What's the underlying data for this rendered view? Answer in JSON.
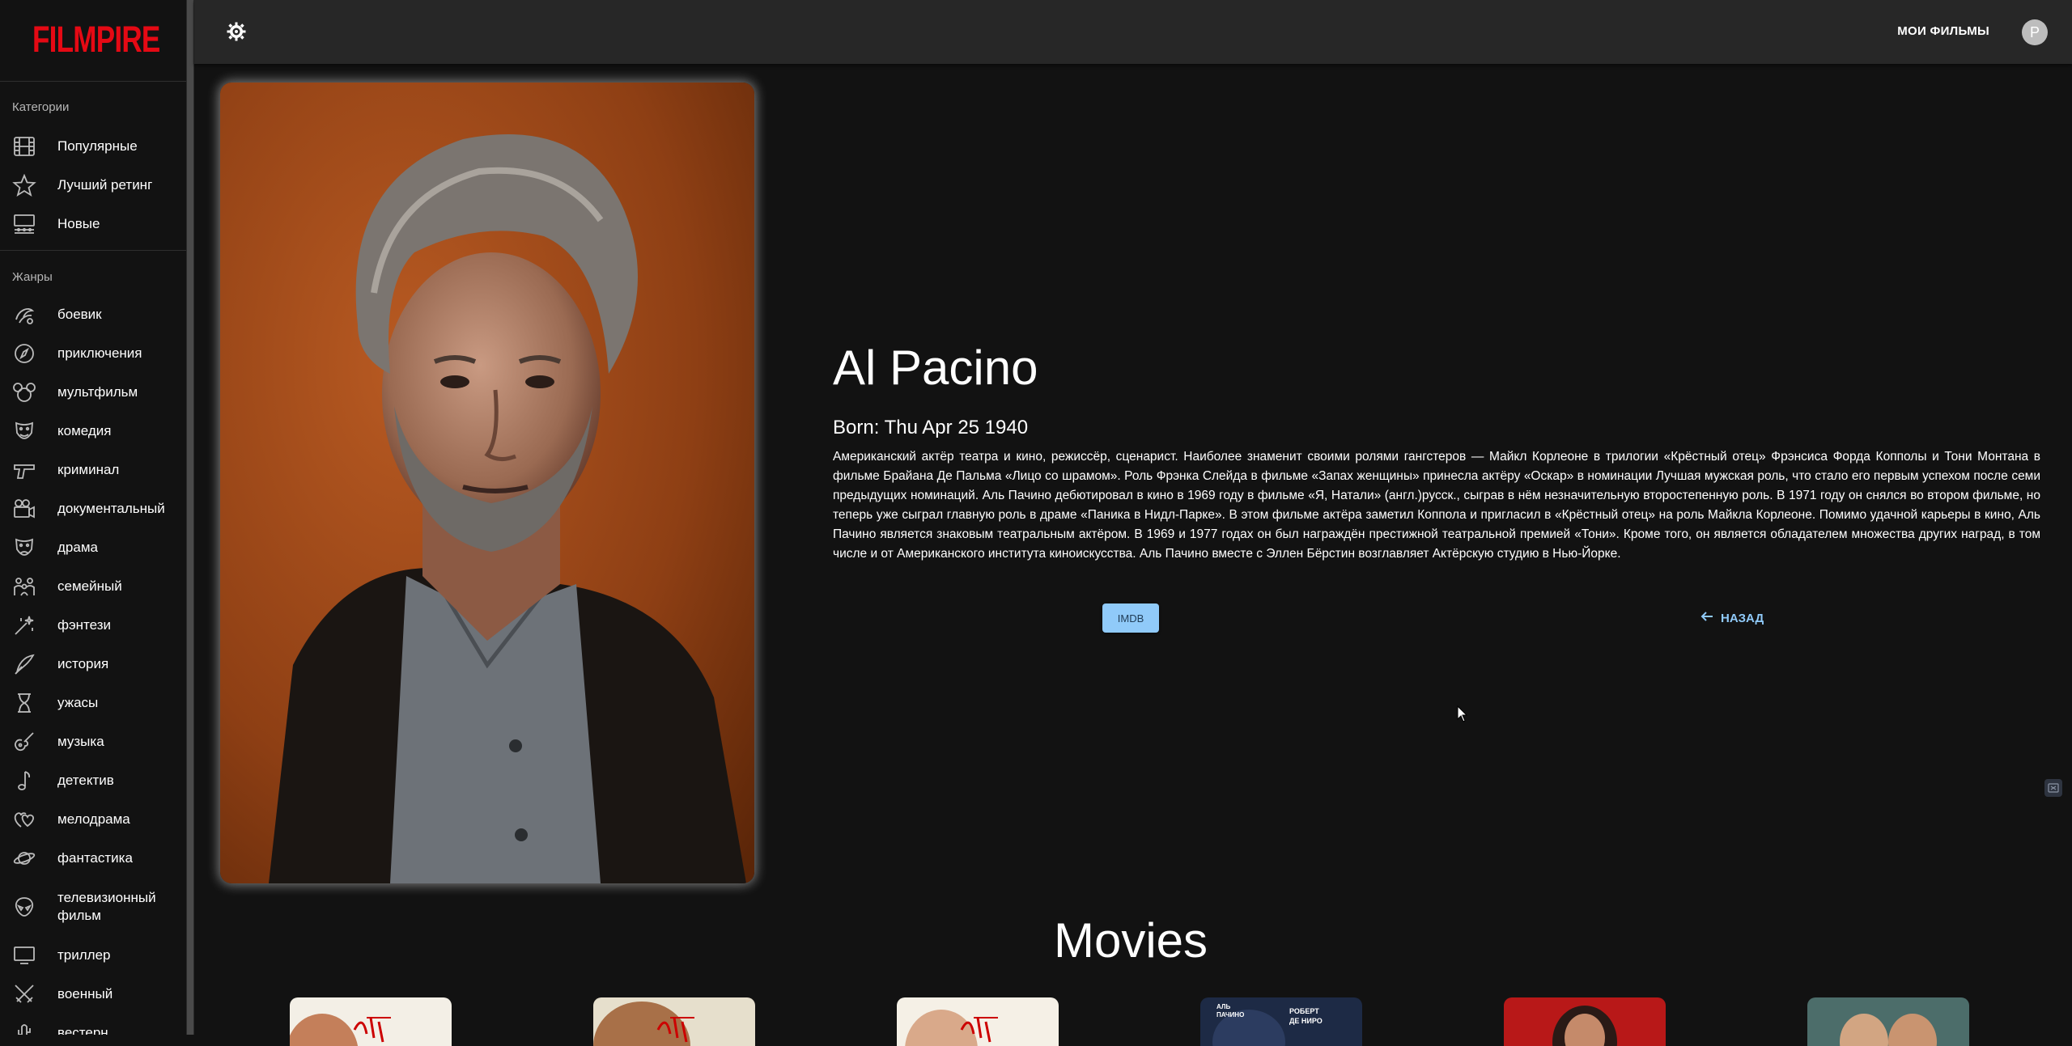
{
  "app": {
    "logo": "FILMPIRE"
  },
  "sidebar": {
    "categories_heading": "Категории",
    "categories": [
      {
        "label": "Популярные",
        "icon": "film-icon"
      },
      {
        "label": "Лучший ретинг",
        "icon": "star-icon"
      },
      {
        "label": "Новые",
        "icon": "cinema-screen-icon"
      }
    ],
    "genres_heading": "Жанры",
    "genres": [
      {
        "label": "боевик",
        "icon": "action-icon"
      },
      {
        "label": "приключения",
        "icon": "compass-icon"
      },
      {
        "label": "мультфильм",
        "icon": "mouse-ears-icon"
      },
      {
        "label": "комедия",
        "icon": "comedy-mask-icon"
      },
      {
        "label": "криминал",
        "icon": "pistol-icon"
      },
      {
        "label": "документальный",
        "icon": "movie-camera-icon"
      },
      {
        "label": "драма",
        "icon": "drama-mask-icon"
      },
      {
        "label": "семейный",
        "icon": "family-icon"
      },
      {
        "label": "фэнтези",
        "icon": "magic-wand-icon"
      },
      {
        "label": "история",
        "icon": "quill-icon"
      },
      {
        "label": "ужасы",
        "icon": "hourglass-icon"
      },
      {
        "label": "музыка",
        "icon": "guitar-icon"
      },
      {
        "label": "детектив",
        "icon": "music-note-icon"
      },
      {
        "label": "мелодрама",
        "icon": "hearts-icon"
      },
      {
        "label": "фантастика",
        "icon": "planet-icon"
      },
      {
        "label": "телевизионный фильм",
        "icon": "alien-icon"
      },
      {
        "label": "триллер",
        "icon": "tv-icon"
      },
      {
        "label": "военный",
        "icon": "crossed-swords-icon"
      },
      {
        "label": "вестерн",
        "icon": "cactus-icon"
      }
    ]
  },
  "topbar": {
    "settings_icon": "brightness-icon",
    "my_movies_label": "МОИ ФИЛЬМЫ",
    "avatar_letter": "P"
  },
  "person": {
    "name": "Al Pacino",
    "born": "Born: Thu Apr 25 1940",
    "bio": "Американский актёр театра и кино, режиссёр, сценарист. Наиболее знаменит своими ролями гангстеров — Майкл Корлеоне в трилогии «Крёстный отец» Фрэнсиса Форда Копполы и Тони Монтана в фильме Брайана Де Пальма «Лицо со шрамом». Роль Фрэнка Слейда в фильме «Запах женщины» принесла актёру «Оскар» в номинации Лучшая мужская роль, что стало его первым успехом после семи предыдущих номинаций. Аль Пачино дебютировал в кино в 1969 году в фильме «Я, Натали» (англ.)русск., сыграв в нём незначительную второстепенную роль. В 1971 году он снялся во втором фильме, но теперь уже сыграл главную роль в драме «Паника в Нидл-Парке». В этом фильме актёра заметил Коппола и пригласил в «Крёстный отец» на роль Майкла Корлеоне. Помимо удачной карьеры в кино, Аль Пачино является знаковым театральным актёром. В 1969 и 1977 годах он был награждён престижной театральной премией «Тони». Кроме того, он является обладателем множества других наград, в том числе и от Американского института киноискусства. Аль Пачино вместе с Эллен Бёрстин возглавляет Актёрскую студию в Нью-Йорке.",
    "imdb_label": "IMDB",
    "back_label": "НАЗАД"
  },
  "movies": {
    "heading": "Movies",
    "posters": [
      {
        "caption": ""
      },
      {
        "caption": ""
      },
      {
        "caption": ""
      },
      {
        "caption": "АЛЬ ПАЧИНО   РОБЕРТ ДЕ НИРО"
      },
      {
        "caption": ""
      },
      {
        "caption": ""
      }
    ]
  },
  "colors": {
    "brand": "#e50914",
    "background": "#121212",
    "topbar": "#272727",
    "accent": "#90caf9"
  }
}
